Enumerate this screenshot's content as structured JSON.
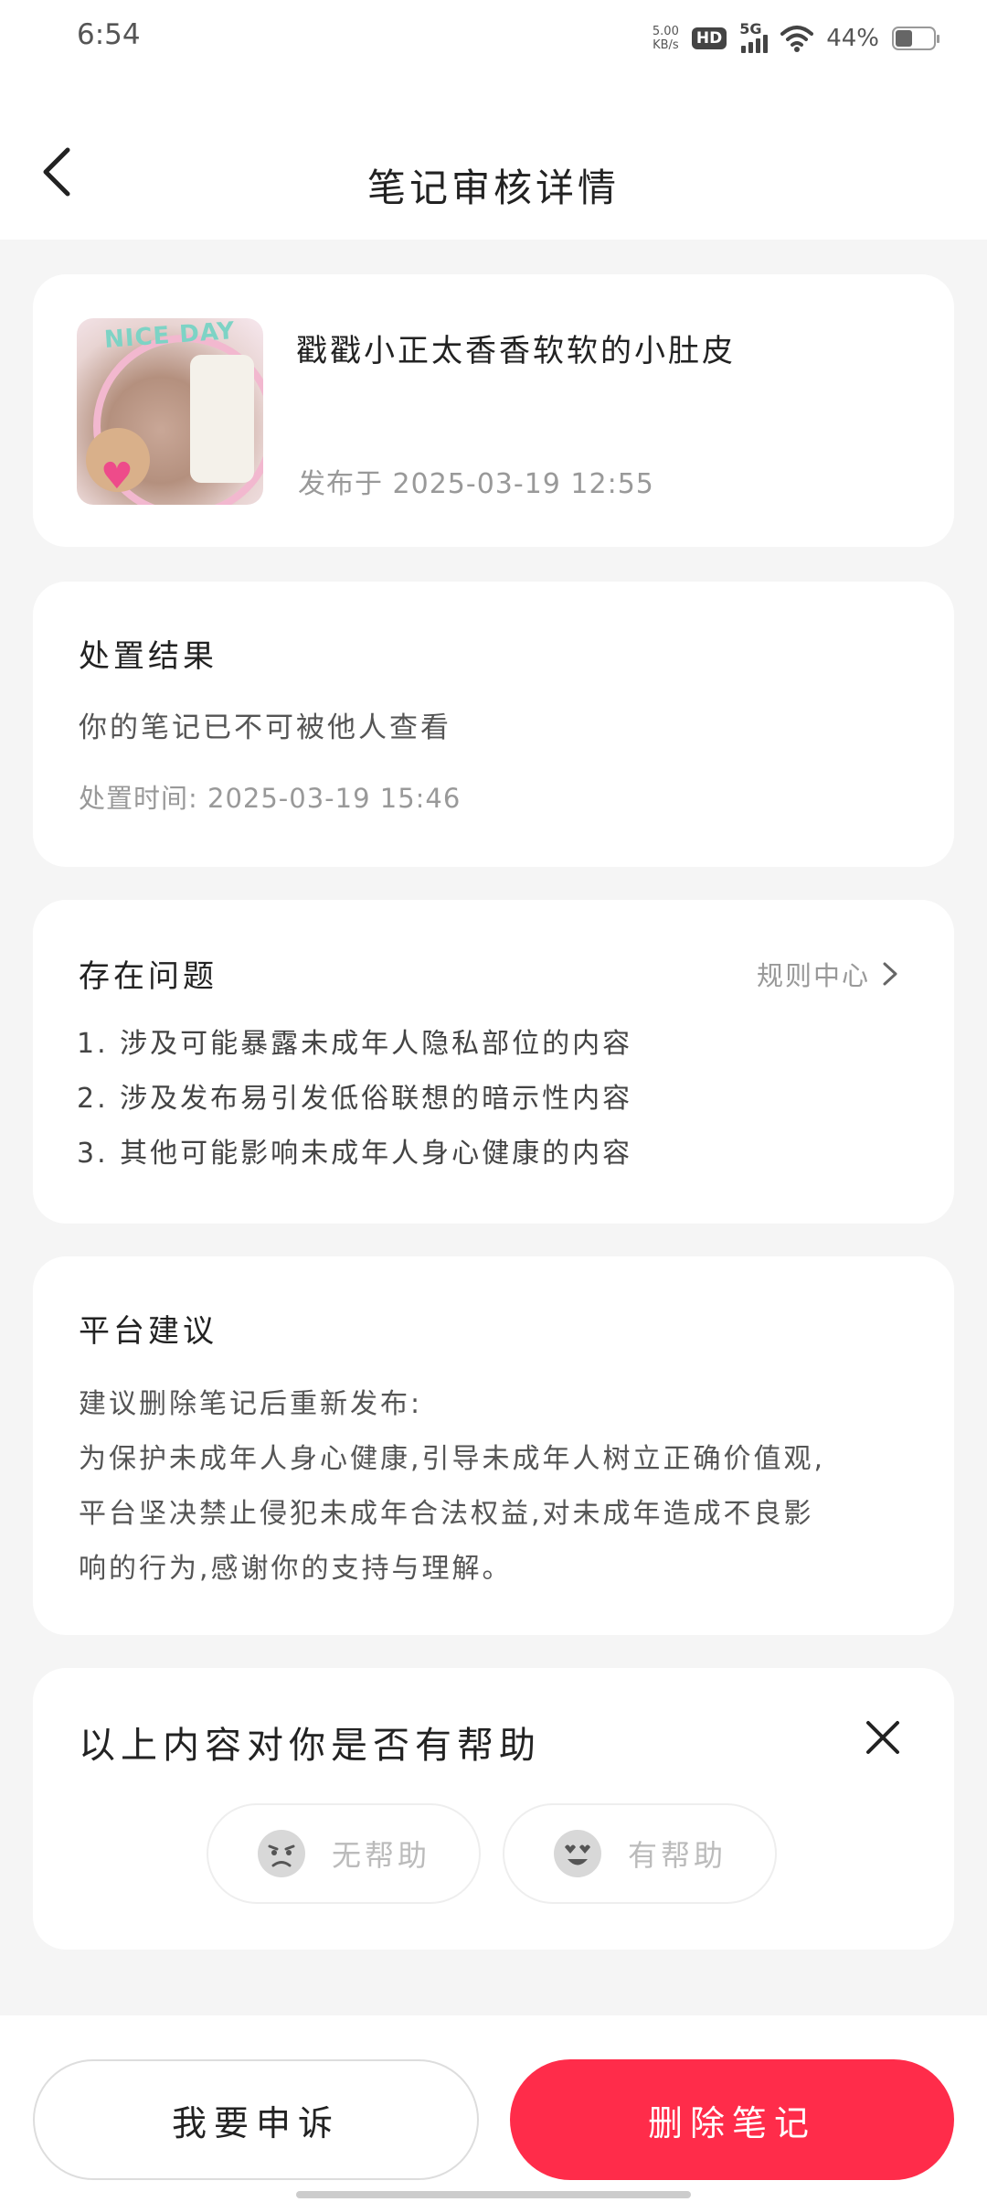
{
  "status_bar": {
    "time": "6:54",
    "net_speed_value": "5.00",
    "net_speed_unit": "KB/s",
    "hd_badge": "HD",
    "network": "5G",
    "battery": "44%"
  },
  "header": {
    "title": "笔记审核详情"
  },
  "note": {
    "title": "戳戳小正太香香软软的小肚皮",
    "published": "发布于 2025-03-19 12:55",
    "thumb_text": "NICE DAY"
  },
  "result": {
    "heading": "处置结果",
    "status": "你的笔记已不可被他人查看",
    "time": "处置时间: 2025-03-19 15:46"
  },
  "issues": {
    "heading": "存在问题",
    "rules_link": "规则中心",
    "items": [
      "1.  涉及可能暴露未成年人隐私部位的内容",
      "2.  涉及发布易引发低俗联想的暗示性内容",
      "3.  其他可能影响未成年人身心健康的内容"
    ]
  },
  "advice": {
    "heading": "平台建议",
    "lines": [
      "建议删除笔记后重新发布:",
      "为保护未成年人身心健康,引导未成年人树立正确价值观,",
      "平台坚决禁止侵犯未成年合法权益,对未成年造成不良影",
      "响的行为,感谢你的支持与理解。"
    ]
  },
  "feedback": {
    "question": "以上内容对你是否有帮助",
    "not_helpful": "无帮助",
    "helpful": "有帮助"
  },
  "actions": {
    "appeal": "我要申诉",
    "delete": "删除笔记"
  },
  "colors": {
    "accent": "#ff2c4a",
    "background": "#f5f5f5",
    "card": "#ffffff"
  }
}
